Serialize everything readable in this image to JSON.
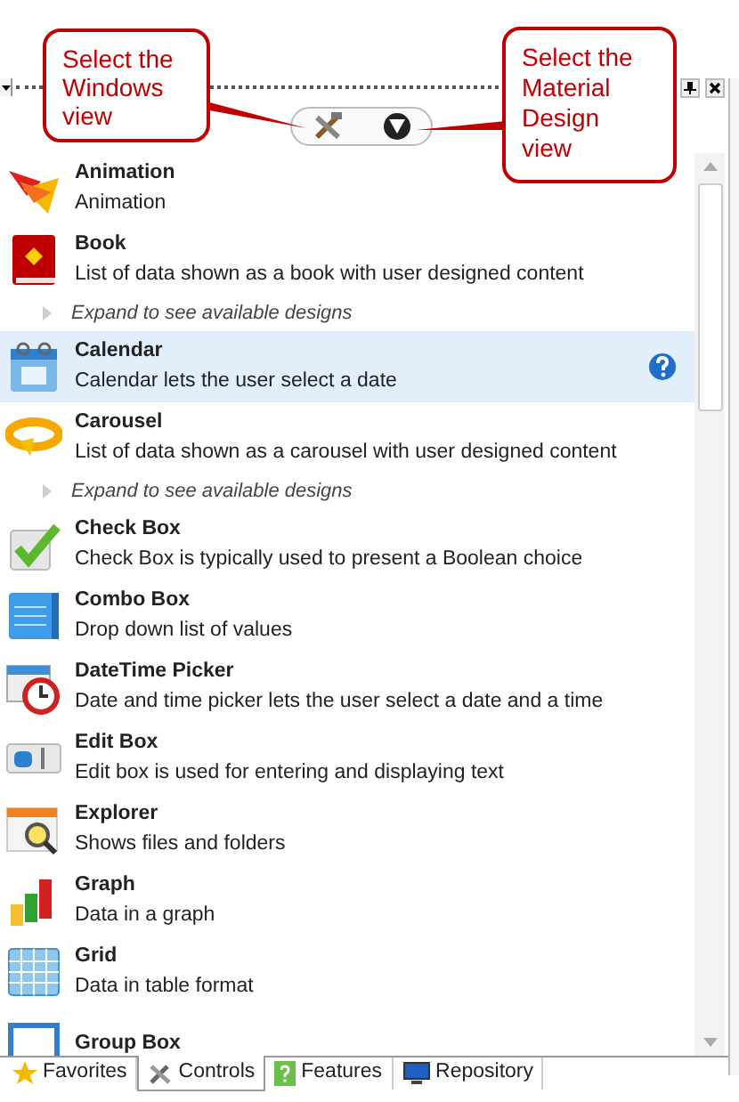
{
  "callouts": [
    {
      "text": "Select the Windows view"
    },
    {
      "text": "Select the Material Design view"
    }
  ],
  "items": [
    {
      "name": "Animation",
      "description": "Animation",
      "selected": false
    },
    {
      "name": "Book",
      "description": "List of data shown as a book with user designed content",
      "expand_hint": "Expand to see available designs",
      "selected": false
    },
    {
      "name": "Calendar",
      "description": "Calendar lets the user select a date",
      "selected": true
    },
    {
      "name": "Carousel",
      "description": "List of data shown as a carousel with user designed content",
      "expand_hint": "Expand to see available designs",
      "selected": false
    },
    {
      "name": "Check Box",
      "description": "Check Box is typically used to present a Boolean choice",
      "selected": false
    },
    {
      "name": "Combo Box",
      "description": "Drop down list of values",
      "selected": false
    },
    {
      "name": "DateTime Picker",
      "description": "Date and time picker lets the user select a date and a time",
      "selected": false
    },
    {
      "name": "Edit Box",
      "description": "Edit box is used for entering and displaying text",
      "selected": false
    },
    {
      "name": "Explorer",
      "description": "Shows files and folders",
      "selected": false
    },
    {
      "name": "Graph",
      "description": "Data in a graph",
      "selected": false
    },
    {
      "name": "Grid",
      "description": "Data in table format",
      "selected": false
    },
    {
      "name": "Group Box",
      "selected": false
    }
  ],
  "tabs": [
    {
      "label": "Favorites",
      "selected": false
    },
    {
      "label": "Controls",
      "selected": true
    },
    {
      "label": "Features",
      "selected": false
    },
    {
      "label": "Repository",
      "selected": false
    }
  ]
}
